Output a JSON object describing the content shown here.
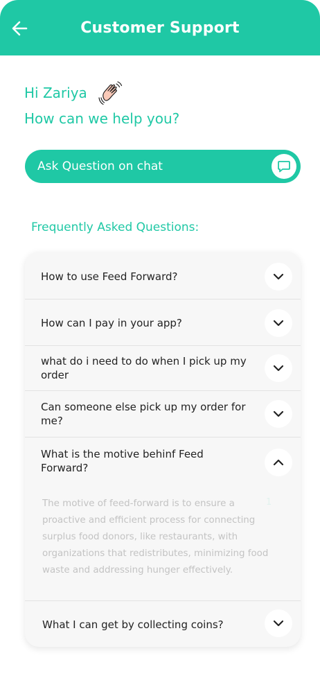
{
  "header": {
    "title": "Customer Support"
  },
  "greeting": {
    "hello": "Hi Zariya",
    "question": "How can we help you?"
  },
  "chat": {
    "label": "Ask Question on chat"
  },
  "faq": {
    "heading": "Frequently Asked Questions:",
    "items": [
      {
        "question": "How to use Feed Forward?",
        "expanded": false
      },
      {
        "question": "How can I pay in your app?",
        "expanded": false
      },
      {
        "question": "what do i need to do when I pick up my order",
        "expanded": false
      },
      {
        "question": "Can someone else pick up my order for me?",
        "expanded": false
      },
      {
        "question": "What is the motive behinf Feed Forward?",
        "expanded": true,
        "answer": "The motive of feed-forward is to ensure a proactive and efficient process for connecting surplus food donors, like restaurants, with organizations that redistributes, minimizing food waste and addressing hunger effectively.",
        "answer_mark": "1"
      },
      {
        "question": "What I can get by collecting coins?",
        "expanded": false
      }
    ]
  },
  "colors": {
    "accent": "#1fc8a5",
    "card_bg": "#f7f7f7",
    "answer_text": "#c3c3c3"
  },
  "icons": {
    "back": "arrow-left",
    "wave": "waving-hand",
    "chat": "chat-bubble",
    "chevron_closed": "chevron-down",
    "chevron_open": "chevron-up"
  }
}
